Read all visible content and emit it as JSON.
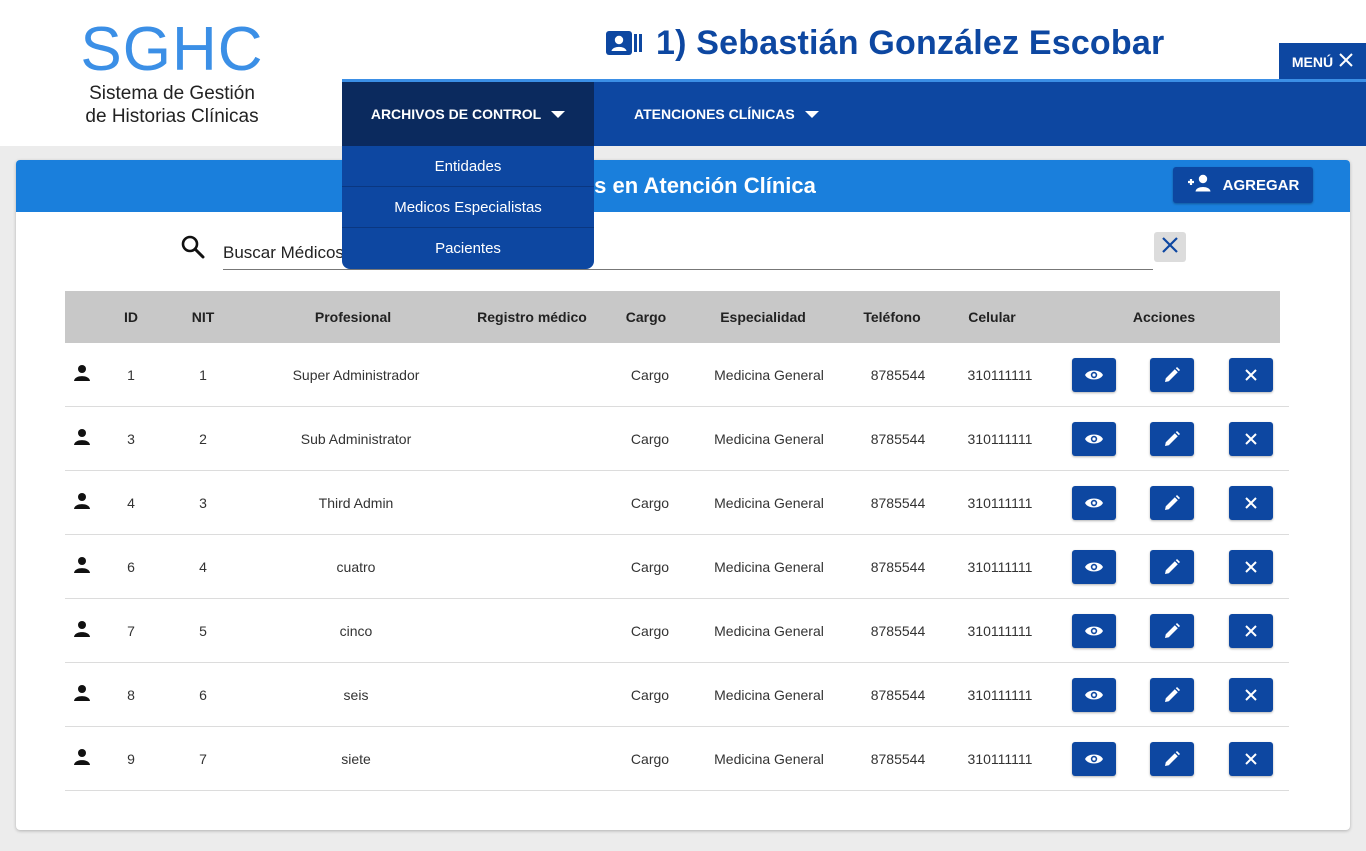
{
  "logo": {
    "title": "SGHC",
    "subtitle_line1": "Sistema de Gestión",
    "subtitle_line2": "de Historias Clínicas"
  },
  "user": {
    "name": "1) Sebastián González Escobar",
    "icon": "user-card-icon"
  },
  "menu_button": {
    "label": "MENÚ",
    "icon": "close-icon"
  },
  "nav": {
    "items": [
      {
        "label": "ARCHIVOS DE CONTROL",
        "active": true
      },
      {
        "label": "ATENCIONES CLÍNICAS",
        "active": false
      }
    ]
  },
  "dropdown": {
    "items": [
      "Entidades",
      "Medicos Especialistas",
      "Pacientes"
    ]
  },
  "panel": {
    "title": "nales en Atención Clínica",
    "add_button": {
      "label": "AGREGAR",
      "icon": "add-person-icon"
    }
  },
  "search": {
    "value": "Buscar Médicos",
    "icon": "search-icon",
    "clear_icon": "close-icon"
  },
  "table": {
    "headers": [
      "ID",
      "NIT",
      "Profesional",
      "Registro médico",
      "Cargo",
      "Especialidad",
      "Teléfono",
      "Celular",
      "Acciones"
    ],
    "rows": [
      {
        "id": "1",
        "nit": "1",
        "profesional": "Super Administrador",
        "registro": "",
        "cargo": "Cargo",
        "especialidad": "Medicina General",
        "telefono": "8785544",
        "celular": "310111111"
      },
      {
        "id": "3",
        "nit": "2",
        "profesional": "Sub Administrator",
        "registro": "",
        "cargo": "Cargo",
        "especialidad": "Medicina General",
        "telefono": "8785544",
        "celular": "310111111"
      },
      {
        "id": "4",
        "nit": "3",
        "profesional": "Third Admin",
        "registro": "",
        "cargo": "Cargo",
        "especialidad": "Medicina General",
        "telefono": "8785544",
        "celular": "310111111"
      },
      {
        "id": "6",
        "nit": "4",
        "profesional": "cuatro",
        "registro": "",
        "cargo": "Cargo",
        "especialidad": "Medicina General",
        "telefono": "8785544",
        "celular": "310111111"
      },
      {
        "id": "7",
        "nit": "5",
        "profesional": "cinco",
        "registro": "",
        "cargo": "Cargo",
        "especialidad": "Medicina General",
        "telefono": "8785544",
        "celular": "310111111"
      },
      {
        "id": "8",
        "nit": "6",
        "profesional": "seis",
        "registro": "",
        "cargo": "Cargo",
        "especialidad": "Medicina General",
        "telefono": "8785544",
        "celular": "310111111"
      },
      {
        "id": "9",
        "nit": "7",
        "profesional": "siete",
        "registro": "",
        "cargo": "Cargo",
        "especialidad": "Medicina General",
        "telefono": "8785544",
        "celular": "310111111"
      }
    ],
    "row_icon": "person-icon",
    "action_icons": [
      "eye-icon",
      "pencil-icon",
      "close-icon"
    ]
  },
  "colors": {
    "primary": "#0d47a1",
    "accent": "#1a7fdc",
    "logo": "#3b8fe6",
    "nav_active": "#0b2a5e"
  }
}
